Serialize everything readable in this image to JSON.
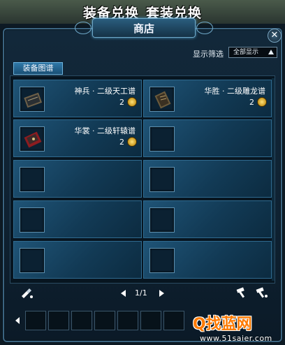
{
  "caption": {
    "left": "装备兑换",
    "right": "套装兑换"
  },
  "window": {
    "title": "商店",
    "close_icon": "close-icon"
  },
  "filter": {
    "label": "显示筛选",
    "selected": "全部显示"
  },
  "tabs": [
    {
      "label": "装备图谱"
    }
  ],
  "items": [
    {
      "name": "神兵 · 二级天工谱",
      "price": "2",
      "icon": "scroll-icon"
    },
    {
      "name": "华胜 · 二级雕龙谱",
      "price": "2",
      "icon": "scroll-icon"
    },
    {
      "name": "华裳 · 二级轩辕谱",
      "price": "2",
      "icon": "book-icon"
    },
    {
      "name": "",
      "price": "",
      "icon": ""
    },
    {
      "name": "",
      "price": "",
      "icon": ""
    },
    {
      "name": "",
      "price": "",
      "icon": ""
    },
    {
      "name": "",
      "price": "",
      "icon": ""
    },
    {
      "name": "",
      "price": "",
      "icon": ""
    },
    {
      "name": "",
      "price": "",
      "icon": ""
    },
    {
      "name": "",
      "price": "",
      "icon": ""
    }
  ],
  "pagination": {
    "text": "1/1"
  },
  "watermark": {
    "logo": "Q找蓝网",
    "url": "www.51saier.com"
  },
  "colors": {
    "accent": "#2f78a8",
    "panel": "#0f2232",
    "coin": "#e0b23a"
  }
}
